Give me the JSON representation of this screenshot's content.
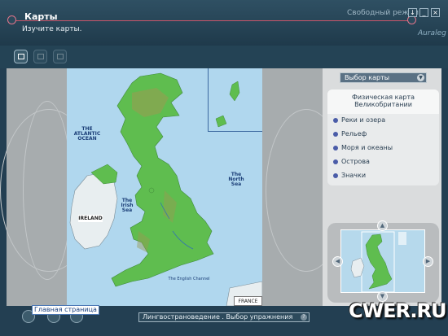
{
  "header": {
    "title": "Карты",
    "subtitle": "Изучите карты.",
    "mode_label": "Свободный режим",
    "logo_text": "Auraleg",
    "window_buttons": [
      "download-icon",
      "minimize-icon",
      "close-icon"
    ]
  },
  "map": {
    "labels": {
      "atlantic": "THE ATLANTIC OCEAN",
      "north_sea": "The North Sea",
      "irish_sea": "The Irish Sea",
      "ireland": "IRELAND",
      "english_channel": "The English Channel",
      "france": "FRANCE"
    }
  },
  "panel": {
    "select_label": "Выбор карты",
    "heading": "Физическая карта Великобритании",
    "items": [
      "Реки и озера",
      "Рельеф",
      "Моря и океаны",
      "Острова",
      "Значки"
    ]
  },
  "footer": {
    "home_tooltip": "Главная страница",
    "status": "Лингвострановедение . Выбор упражнения",
    "help": "?"
  },
  "watermark": "CWER.RU",
  "colors": {
    "frame": "#233f52",
    "accent_rail": "#c8566b",
    "land_green": "#5fbd4f",
    "sea": "#b0d7ee"
  }
}
